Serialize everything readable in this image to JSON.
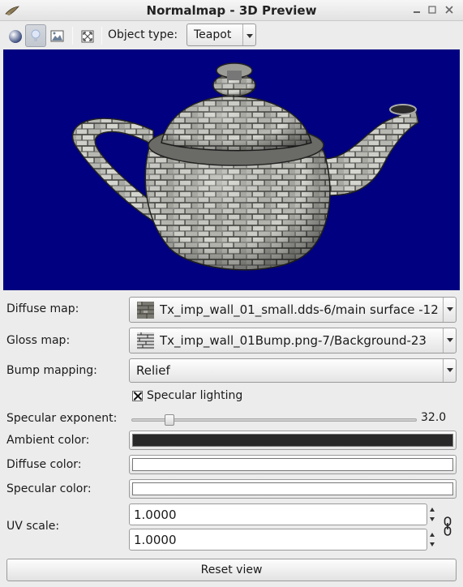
{
  "window": {
    "title": "Normalmap - 3D Preview",
    "minimize_icon": "minimize-icon",
    "maximize_icon": "maximize-icon",
    "close_icon": "close-icon"
  },
  "toolbar": {
    "object_type_label": "Object type:",
    "object_type_value": "Teapot",
    "buttons": [
      "sphere-lighting-icon",
      "light-bulb-icon",
      "image-icon",
      "fullscreen-icon"
    ]
  },
  "form": {
    "diffuse_map": {
      "label": "Diffuse map:",
      "value": "Tx_imp_wall_01_small.dds-6/main surface -12"
    },
    "gloss_map": {
      "label": "Gloss map:",
      "value": "Tx_imp_wall_01Bump.png-7/Background-23"
    },
    "bump_mapping": {
      "label": "Bump mapping:",
      "value": "Relief"
    },
    "specular_lighting": {
      "label": "Specular lighting",
      "checked": true
    },
    "specular_exponent": {
      "label": "Specular exponent:",
      "value": "32.0",
      "fraction": 0.12
    },
    "ambient_color": {
      "label": "Ambient color:",
      "color": "#282828"
    },
    "diffuse_color": {
      "label": "Diffuse color:",
      "color": "#ffffff"
    },
    "specular_color": {
      "label": "Specular color:",
      "color": "#ffffff"
    },
    "uv_scale": {
      "label": "UV scale:",
      "u": "1.0000",
      "v": "1.0000"
    }
  },
  "reset_label": "Reset view",
  "colors": {
    "viewport_background": "#000080",
    "window_background": "#ececec"
  }
}
